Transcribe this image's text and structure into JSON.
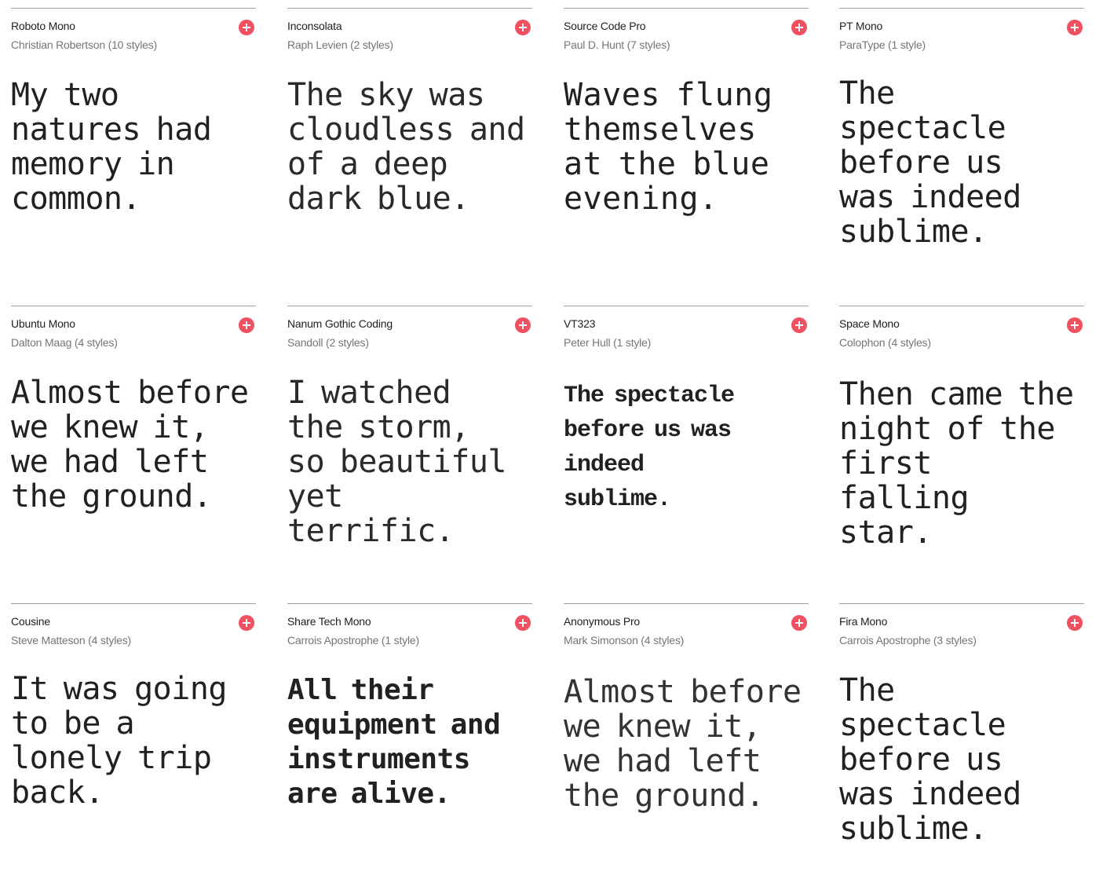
{
  "colors": {
    "accent": "#ef5161",
    "divider": "#9e9e9e",
    "meta_text": "#757575",
    "text": "#212121"
  },
  "icons": {
    "add": "plus-circle-icon"
  },
  "fonts": [
    {
      "name": "Roboto Mono",
      "meta": "Christian Robertson (10 styles)",
      "sample": "My two natures had memory in common."
    },
    {
      "name": "Inconsolata",
      "meta": "Raph Levien (2 styles)",
      "sample": "The sky was cloudless and of a deep dark blue."
    },
    {
      "name": "Source Code Pro",
      "meta": "Paul D. Hunt (7 styles)",
      "sample": "Waves flung themselves at the blue evening."
    },
    {
      "name": "PT Mono",
      "meta": "ParaType (1 style)",
      "sample": "The spectacle before us was indeed sublime."
    },
    {
      "name": "Ubuntu Mono",
      "meta": "Dalton Maag (4 styles)",
      "sample": "Almost before we knew it, we had left the ground."
    },
    {
      "name": "Nanum Gothic Coding",
      "meta": "Sandoll (2 styles)",
      "sample": "I watched the storm, so beautiful yet terrific."
    },
    {
      "name": "VT323",
      "meta": "Peter Hull (1 style)",
      "sample": "The spectacle before us was indeed sublime."
    },
    {
      "name": "Space Mono",
      "meta": "Colophon (4 styles)",
      "sample": "Then came the night of the first falling star."
    },
    {
      "name": "Cousine",
      "meta": "Steve Matteson (4 styles)",
      "sample": "It was going to be a lonely trip back."
    },
    {
      "name": "Share Tech Mono",
      "meta": "Carrois Apostrophe (1 style)",
      "sample": "All their equipment and instruments are alive."
    },
    {
      "name": "Anonymous Pro",
      "meta": "Mark Simonson (4 styles)",
      "sample": "Almost before we knew it, we had left the ground."
    },
    {
      "name": "Fira Mono",
      "meta": "Carrois Apostrophe (3 styles)",
      "sample": "The spectacle before us was indeed sublime."
    }
  ]
}
